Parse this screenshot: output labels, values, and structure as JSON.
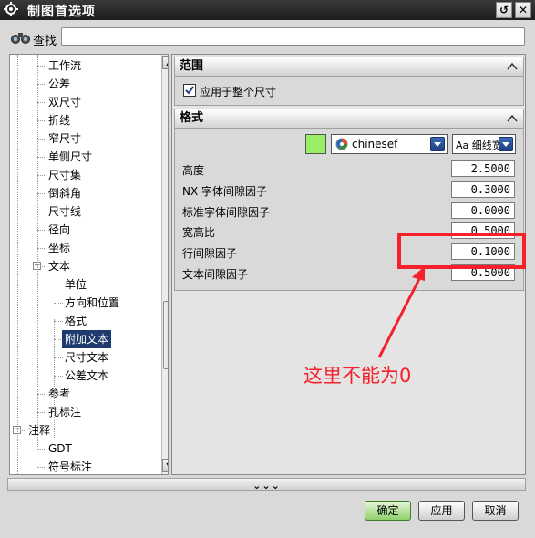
{
  "window": {
    "title": "制图首选项",
    "restore_label": "↺",
    "close_label": "✕"
  },
  "find": {
    "label": "查找",
    "value": "",
    "placeholder": ""
  },
  "tree": {
    "items": [
      {
        "label": "工作流",
        "level": 2
      },
      {
        "label": "公差",
        "level": 2
      },
      {
        "label": "双尺寸",
        "level": 2
      },
      {
        "label": "折线",
        "level": 2
      },
      {
        "label": "窄尺寸",
        "level": 2
      },
      {
        "label": "单侧尺寸",
        "level": 2
      },
      {
        "label": "尺寸集",
        "level": 2
      },
      {
        "label": "倒斜角",
        "level": 2
      },
      {
        "label": "尺寸线",
        "level": 2
      },
      {
        "label": "径向",
        "level": 2
      },
      {
        "label": "坐标",
        "level": 2
      },
      {
        "label": "文本",
        "level": 2,
        "expander": "−"
      },
      {
        "label": "单位",
        "level": 3
      },
      {
        "label": "方向和位置",
        "level": 3
      },
      {
        "label": "格式",
        "level": 3
      },
      {
        "label": "附加文本",
        "level": 3,
        "selected": true
      },
      {
        "label": "尺寸文本",
        "level": 3
      },
      {
        "label": "公差文本",
        "level": 3
      },
      {
        "label": "参考",
        "level": 2
      },
      {
        "label": "孔标注",
        "level": 2
      },
      {
        "label": "注释",
        "level": 1,
        "expander": "−"
      },
      {
        "label": "GDT",
        "level": 2
      },
      {
        "label": "符号标注",
        "level": 2
      }
    ]
  },
  "scope": {
    "header": "范围",
    "checkbox_label": "应用于整个尺寸",
    "checked": true
  },
  "format": {
    "header": "格式",
    "color": "#99ee66",
    "font_name": "chinesef",
    "style_label": "Aa 细线宽",
    "fields": [
      {
        "label": "高度",
        "value": "2.5000"
      },
      {
        "label": "NX 字体间隙因子",
        "value": "0.3000"
      },
      {
        "label": "标准字体间隙因子",
        "value": "0.0000"
      },
      {
        "label": "宽高比",
        "value": "0.5000"
      },
      {
        "label": "行间隙因子",
        "value": "0.1000"
      },
      {
        "label": "文本间隙因子",
        "value": "0.5000"
      }
    ]
  },
  "more_label": "⌄⌄⌄",
  "buttons": {
    "ok": "确定",
    "apply": "应用",
    "cancel": "取消"
  },
  "annotation": {
    "text": "这里不能为0",
    "color": "#f5202a"
  }
}
